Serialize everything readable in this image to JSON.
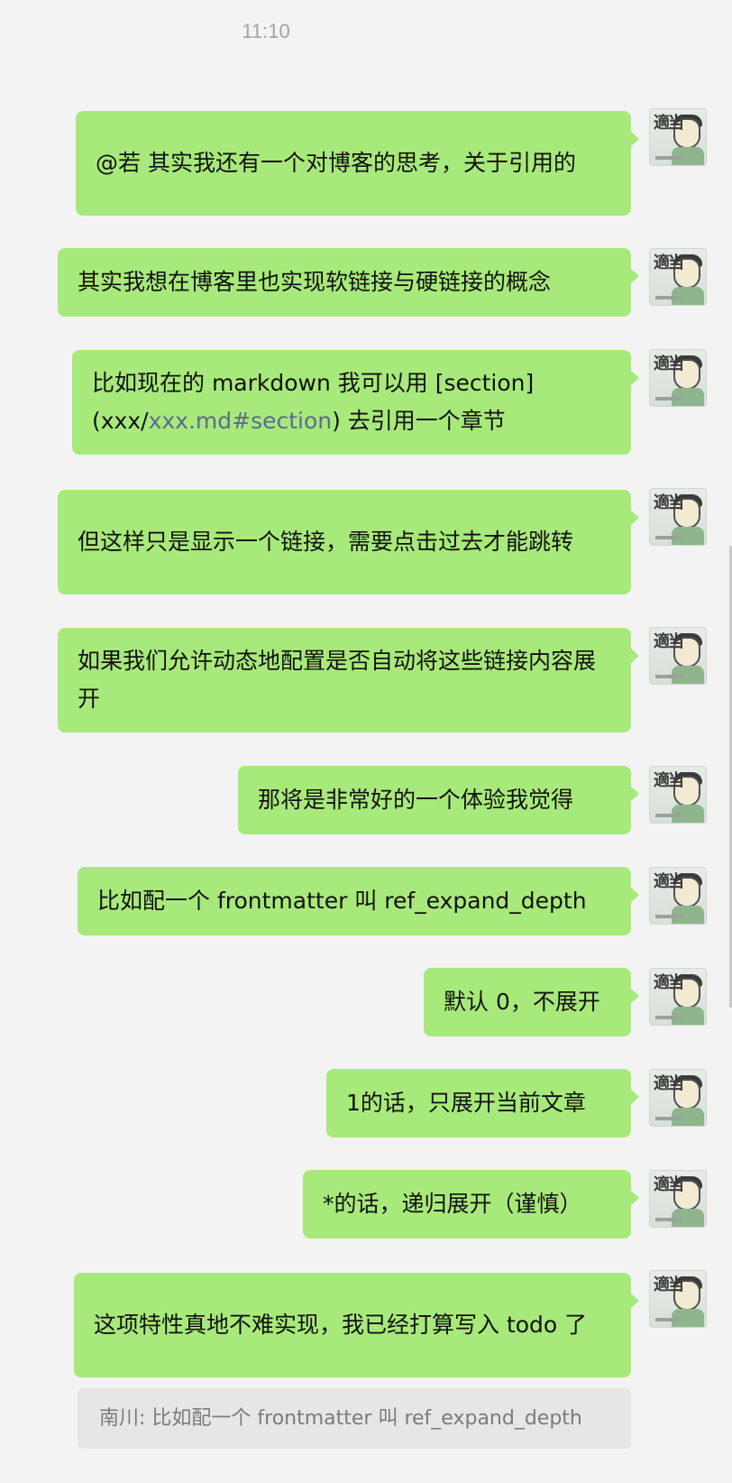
{
  "timestamp": "11:10",
  "messages": [
    {
      "text": "@若 其实我还有一个对博客的思考，关于引用的"
    },
    {
      "text": "其实我想在博客里也实现软链接与硬链接的概念"
    },
    {
      "text_before": "比如现在的 markdown 我可以用 [section](xxx/",
      "link": "xxx.md#section",
      "text_after": ") 去引用一个章节"
    },
    {
      "text": "但这样只是显示一个链接，需要点击过去才能跳转"
    },
    {
      "text": "如果我们允许动态地配置是否自动将这些链接内容展开"
    },
    {
      "text": "那将是非常好的一个体验我觉得"
    },
    {
      "text": "比如配一个 frontmatter 叫 ref_expand_depth"
    },
    {
      "text": "默认 0，不展开"
    },
    {
      "text": "1的话，只展开当前文章"
    },
    {
      "text": "*的话，递归展开（谨慎）"
    },
    {
      "text": "这项特性真地不难实现，我已经打算写入 todo 了"
    }
  ],
  "quote": {
    "text": "南川: 比如配一个 frontmatter 叫 ref_expand_depth"
  },
  "avatar": {
    "glyph": "適当",
    "icon": "cartoon-avatar-icon"
  },
  "colors": {
    "bubble": "#a8e97b",
    "background": "#f3f3f3",
    "link": "#5b6c8f"
  }
}
